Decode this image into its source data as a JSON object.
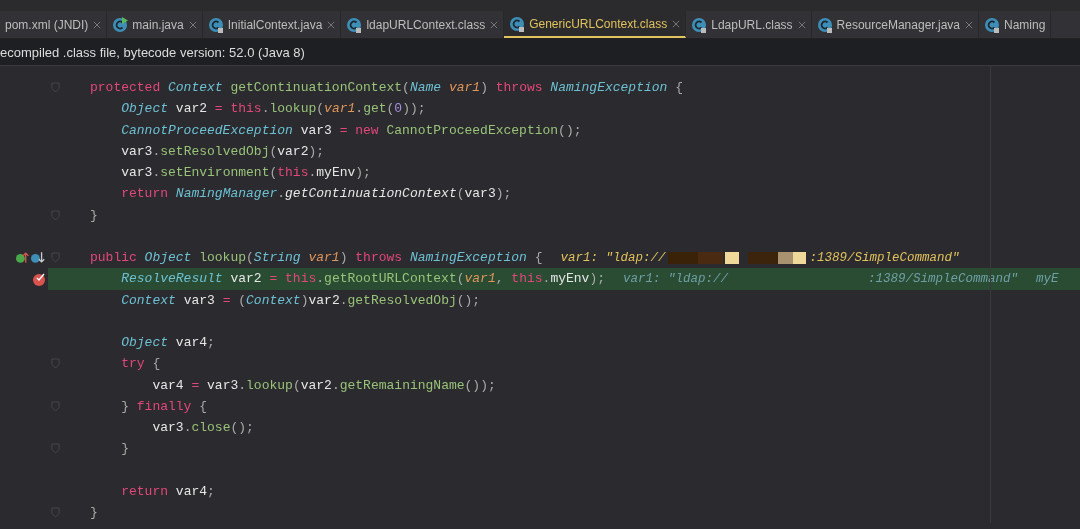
{
  "tabs": [
    {
      "label": "pom.xml (JNDI)",
      "kind": "plain",
      "selected": false
    },
    {
      "label": "main.java",
      "kind": "runnable",
      "selected": false
    },
    {
      "label": "InitialContext.java",
      "kind": "locked",
      "selected": false
    },
    {
      "label": "ldapURLContext.class",
      "kind": "locked",
      "selected": false
    },
    {
      "label": "GenericURLContext.class",
      "kind": "locked",
      "selected": true
    },
    {
      "label": "LdapURL.class",
      "kind": "locked",
      "selected": false
    },
    {
      "label": "ResourceManager.java",
      "kind": "locked",
      "selected": false
    },
    {
      "label": "Naming",
      "kind": "locked",
      "selected": false
    }
  ],
  "info_bar": {
    "text": "ecompiled .class file, bytecode version: 52.0 (Java 8)"
  },
  "code_lines": [
    {
      "kind": "code",
      "current": false,
      "fold": true,
      "tokens": [
        {
          "kind": "keyword",
          "text": "protected "
        },
        {
          "kind": "type",
          "text": "Context "
        },
        {
          "kind": "method",
          "text": "getContinuationContext"
        },
        {
          "kind": "punct",
          "text": "("
        },
        {
          "kind": "type",
          "text": "Name "
        },
        {
          "kind": "param",
          "text": "var1"
        },
        {
          "kind": "punct",
          "text": ") "
        },
        {
          "kind": "keyword",
          "text": "throws "
        },
        {
          "kind": "type",
          "text": "NamingException "
        },
        {
          "kind": "punct",
          "text": "{"
        }
      ]
    },
    {
      "kind": "code",
      "current": false,
      "fold": false,
      "tokens": [
        {
          "kind": "type",
          "text": "    Object "
        },
        {
          "kind": "plain",
          "text": "var2 "
        },
        {
          "kind": "keyword",
          "text": "= this"
        },
        {
          "kind": "punct",
          "text": "."
        },
        {
          "kind": "method",
          "text": "lookup"
        },
        {
          "kind": "punct",
          "text": "("
        },
        {
          "kind": "param",
          "text": "var1"
        },
        {
          "kind": "punct",
          "text": "."
        },
        {
          "kind": "method",
          "text": "get"
        },
        {
          "kind": "punct",
          "text": "("
        },
        {
          "kind": "number",
          "text": "0"
        },
        {
          "kind": "punct",
          "text": "));"
        }
      ]
    },
    {
      "kind": "code",
      "current": false,
      "fold": false,
      "tokens": [
        {
          "kind": "type",
          "text": "    CannotProceedException "
        },
        {
          "kind": "plain",
          "text": "var3 "
        },
        {
          "kind": "keyword",
          "text": "= new "
        },
        {
          "kind": "method",
          "text": "CannotProceedException"
        },
        {
          "kind": "punct",
          "text": "();"
        }
      ]
    },
    {
      "kind": "code",
      "current": false,
      "fold": false,
      "tokens": [
        {
          "kind": "plain",
          "text": "    var3"
        },
        {
          "kind": "punct",
          "text": "."
        },
        {
          "kind": "method",
          "text": "setResolvedObj"
        },
        {
          "kind": "punct",
          "text": "("
        },
        {
          "kind": "plain",
          "text": "var2"
        },
        {
          "kind": "punct",
          "text": ");"
        }
      ]
    },
    {
      "kind": "code",
      "current": false,
      "fold": false,
      "tokens": [
        {
          "kind": "plain",
          "text": "    var3"
        },
        {
          "kind": "punct",
          "text": "."
        },
        {
          "kind": "method",
          "text": "setEnvironment"
        },
        {
          "kind": "punct",
          "text": "("
        },
        {
          "kind": "keyword",
          "text": "this"
        },
        {
          "kind": "punct",
          "text": "."
        },
        {
          "kind": "plain",
          "text": "myEnv"
        },
        {
          "kind": "punct",
          "text": ");"
        }
      ]
    },
    {
      "kind": "code",
      "current": false,
      "fold": false,
      "tokens": [
        {
          "kind": "keyword",
          "text": "    return "
        },
        {
          "kind": "type",
          "text": "NamingManager"
        },
        {
          "kind": "punct",
          "text": "."
        },
        {
          "kind": "static",
          "text": "getContinuationContext"
        },
        {
          "kind": "punct",
          "text": "("
        },
        {
          "kind": "plain",
          "text": "var3"
        },
        {
          "kind": "punct",
          "text": ");"
        }
      ]
    },
    {
      "kind": "code",
      "current": false,
      "fold": true,
      "tokens": [
        {
          "kind": "punct",
          "text": "}"
        }
      ]
    },
    {
      "kind": "blank",
      "current": false,
      "fold": false
    },
    {
      "kind": "override",
      "current": false,
      "fold": true,
      "tokens": [
        {
          "kind": "keyword",
          "text": "public "
        },
        {
          "kind": "type",
          "text": "Object "
        },
        {
          "kind": "method",
          "text": "lookup"
        },
        {
          "kind": "punct",
          "text": "("
        },
        {
          "kind": "type",
          "text": "String "
        },
        {
          "kind": "param",
          "text": "var1"
        },
        {
          "kind": "punct",
          "text": ") "
        },
        {
          "kind": "keyword",
          "text": "throws "
        },
        {
          "kind": "type",
          "text": "NamingException "
        },
        {
          "kind": "punct",
          "text": "{"
        }
      ],
      "hint": {
        "kind": "value",
        "before": "var1: \"ldap://",
        "after": ":1389/SimpleCommand\""
      }
    },
    {
      "kind": "breakpoint",
      "current": true,
      "fold": false,
      "tokens": [
        {
          "kind": "type",
          "text": "    ResolveResult "
        },
        {
          "kind": "plain",
          "text": "var2 "
        },
        {
          "kind": "keyword",
          "text": "= this"
        },
        {
          "kind": "punct",
          "text": "."
        },
        {
          "kind": "method",
          "text": "getRootURLContext"
        },
        {
          "kind": "punct",
          "text": "("
        },
        {
          "kind": "param",
          "text": "var1"
        },
        {
          "kind": "punct",
          "text": ", "
        },
        {
          "kind": "keyword",
          "text": "this"
        },
        {
          "kind": "punct",
          "text": "."
        },
        {
          "kind": "plain",
          "text": "myEnv"
        },
        {
          "kind": "punct",
          "text": ");"
        }
      ],
      "hint": {
        "kind": "debug",
        "before": "var1: \"ldap://",
        "after": ":1389/SimpleCommand\"",
        "extra": "myE"
      }
    },
    {
      "kind": "code",
      "current": false,
      "fold": false,
      "tokens": [
        {
          "kind": "type",
          "text": "    Context "
        },
        {
          "kind": "plain",
          "text": "var3 "
        },
        {
          "kind": "keyword",
          "text": "= "
        },
        {
          "kind": "punct",
          "text": "("
        },
        {
          "kind": "type",
          "text": "Context"
        },
        {
          "kind": "punct",
          "text": ")"
        },
        {
          "kind": "plain",
          "text": "var2"
        },
        {
          "kind": "punct",
          "text": "."
        },
        {
          "kind": "method",
          "text": "getResolvedObj"
        },
        {
          "kind": "punct",
          "text": "();"
        }
      ]
    },
    {
      "kind": "blank",
      "current": false,
      "fold": false
    },
    {
      "kind": "code",
      "current": false,
      "fold": false,
      "tokens": [
        {
          "kind": "type",
          "text": "    Object "
        },
        {
          "kind": "plain",
          "text": "var4"
        },
        {
          "kind": "punct",
          "text": ";"
        }
      ]
    },
    {
      "kind": "code",
      "current": false,
      "fold": true,
      "tokens": [
        {
          "kind": "keyword",
          "text": "    try "
        },
        {
          "kind": "punct",
          "text": "{"
        }
      ]
    },
    {
      "kind": "code",
      "current": false,
      "fold": false,
      "tokens": [
        {
          "kind": "plain",
          "text": "        var4 "
        },
        {
          "kind": "keyword",
          "text": "= "
        },
        {
          "kind": "plain",
          "text": "var3"
        },
        {
          "kind": "punct",
          "text": "."
        },
        {
          "kind": "method",
          "text": "lookup"
        },
        {
          "kind": "punct",
          "text": "("
        },
        {
          "kind": "plain",
          "text": "var2"
        },
        {
          "kind": "punct",
          "text": "."
        },
        {
          "kind": "method",
          "text": "getRemainingName"
        },
        {
          "kind": "punct",
          "text": "());"
        }
      ]
    },
    {
      "kind": "code",
      "current": false,
      "fold": true,
      "tokens": [
        {
          "kind": "punct",
          "text": "    } "
        },
        {
          "kind": "keyword",
          "text": "finally "
        },
        {
          "kind": "punct",
          "text": "{"
        }
      ]
    },
    {
      "kind": "code",
      "current": false,
      "fold": false,
      "tokens": [
        {
          "kind": "plain",
          "text": "        var3"
        },
        {
          "kind": "punct",
          "text": "."
        },
        {
          "kind": "method",
          "text": "close"
        },
        {
          "kind": "punct",
          "text": "();"
        }
      ]
    },
    {
      "kind": "code",
      "current": false,
      "fold": true,
      "tokens": [
        {
          "kind": "punct",
          "text": "    }"
        }
      ]
    },
    {
      "kind": "blank",
      "current": false,
      "fold": false
    },
    {
      "kind": "code",
      "current": false,
      "fold": false,
      "tokens": [
        {
          "kind": "keyword",
          "text": "    return "
        },
        {
          "kind": "plain",
          "text": "var4"
        },
        {
          "kind": "punct",
          "text": ";"
        }
      ]
    },
    {
      "kind": "code",
      "current": false,
      "fold": true,
      "tokens": [
        {
          "kind": "punct",
          "text": "}"
        }
      ]
    }
  ]
}
